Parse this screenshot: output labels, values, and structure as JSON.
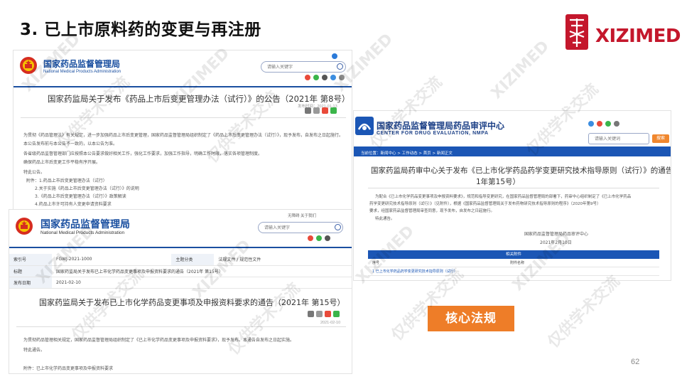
{
  "slide": {
    "title": "3. 已上市原料药的变更与再注册",
    "page_number": "62",
    "core_badge": "核心法规"
  },
  "logo": {
    "text": "XIZIMED",
    "brand_color": "#c4172c"
  },
  "watermark": {
    "brand": "XIZIMED",
    "notice": "仅供学术交流"
  },
  "shot1": {
    "org_cn": "国家药品监督管理局",
    "org_en": "National Medical Products Administration",
    "search_placeholder": "请输入关键字",
    "article_title": "国家药监局关于发布《药品上市后变更管理办法（试行）》的公告（2021年 第8号）",
    "date": "发布时间：2021-01-13",
    "lines": [
      "为贯彻《药品管理法》有关规定，进一步加强药品上市后变更管理，国家药品监督管理局组织制定了《药品上市后变更管理办法（试行）》，现予发布，自发布之日起施行。",
      "本公告发布前与本公告不一致的，以本公告为准。",
      "各省级药品监督管理部门应按照本公告要求做好相关工作，强化工作要求，加强工作指导，明确工作时限，落实各项管理制度。",
      "确保药品上市后变更工作平稳有序开展。",
      "特此公告。",
      "附件：1.药品上市后变更管理办法（试行）",
      "2.关于实施《药品上市后变更管理办法（试行）》的说明",
      "3.《药品上市后变更管理办法（试行）》政策解读",
      "4.药品上市许可持有人变更申请资料要求"
    ]
  },
  "shot2": {
    "org_cn": "国家药品监督管理局",
    "org_en": "National Medical Products Administration",
    "search_placeholder": "请输入关键字",
    "top_links": "无障碍 关于我们",
    "table": {
      "row1_label": "索引号",
      "row1_value": "FGWJ-2021-1000",
      "row1_label2": "主题分类",
      "row1_value2": "法规文件 / 规范性文件",
      "row2_label": "标题",
      "row2_value": "国家药监局关于发布已上市化学药品变更事项及申报资料要求的通告（2021年 第15号）",
      "row3_label": "发布日期",
      "row3_value": "2021-02-10"
    },
    "article_title": "国家药监局关于发布已上市化学药品变更事项及申报资料要求的通告（2021年 第15号）",
    "date": "2021-02-10",
    "lines": [
      "为贯彻药品管理相关规定，国家药品监督管理局组织制定了《已上市化学药品变更事项及申报资料要求》，现予发布。本通告自发布之日起实施。",
      "特此通告。"
    ],
    "attachment": "附件：已上市化学药品变更事项及申报资料要求"
  },
  "shot3": {
    "org_cn": "国家药品监督管理局药品审评中心",
    "org_en": "CENTER FOR DRUG EVALUATION, NMPA",
    "search_placeholder": "请输入关键词",
    "search_button": "搜索",
    "breadcrumb": "当前位置：新闻中心 > 工作动态 > 首页 > 新闻正文",
    "article_title_1": "国家药监局药审中心关于发布《已上市化学药品药学变更研究技术指导原则（试行）》的通告（202",
    "article_title_2": "1年第15号）",
    "lines": [
      "为配合《已上市化学药品变更事项及申报资料要求》，规范和指导变更研究，在国家药品监督管理局的部署下，药审中心组织制定了《已上市化学药品",
      "药学变更研究技术指导原则（试行）》（见附件），根据《国家药品监督管理局关于发布药物研究技术指导原则的程序》（2020年第9号）",
      "要求，经国家药品监督管理局审查同意，现予发布，自发布之日起施行。",
      "特此通告。"
    ],
    "sign_org": "国家药品监督管理局药品审评中心",
    "sign_date": "2021年2月10日",
    "attach_header": "相关附件",
    "attach_cols": [
      "序号",
      "附件名称"
    ],
    "attach_rows": [
      "1  已上市化学药品药学变更研究技术指导原则（试行）"
    ]
  }
}
